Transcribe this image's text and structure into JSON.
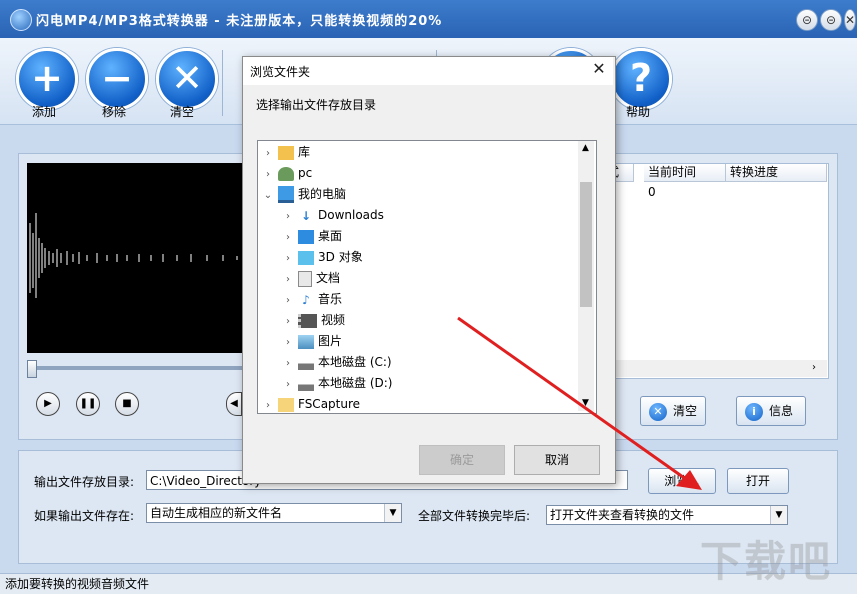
{
  "app": {
    "title": "闪电MP4/MP3格式转换器 - 未注册版本，只能转换视频的20%",
    "window_buttons": [
      "⊝",
      "⊝",
      "✕"
    ]
  },
  "toolbar": {
    "add_label": "添加",
    "remove_label": "移除",
    "clear_label": "清空",
    "help_label": "帮助"
  },
  "file_table": {
    "columns": [
      "格式",
      "当前时间",
      "转换进度"
    ],
    "row_current_time": "0"
  },
  "actions": {
    "clear_label": "清空",
    "info_label": "信息"
  },
  "output": {
    "dir_label": "输出文件存放目录:",
    "dir_value": "C:\\Video_Directory",
    "browse_label": "浏览...",
    "open_label": "打开",
    "exists_label": "如果输出文件存在:",
    "exists_value": "自动生成相应的新文件名",
    "done_label": "全部文件转换完毕后:",
    "done_value": "打开文件夹查看转换的文件"
  },
  "status_text": "添加要转换的视频音频文件",
  "watermark": "下载吧",
  "dialog": {
    "title": "浏览文件夹",
    "instruction": "选择输出文件存放目录",
    "ok_label": "确定",
    "cancel_label": "取消",
    "tree": [
      {
        "label": "库",
        "icon": "library-icon"
      },
      {
        "label": "pc",
        "icon": "user-icon"
      },
      {
        "label": "我的电脑",
        "icon": "computer-icon"
      },
      {
        "label": "Downloads",
        "icon": "downloads-icon"
      },
      {
        "label": "桌面",
        "icon": "desktop-icon"
      },
      {
        "label": "3D 对象",
        "icon": "3d-objects-icon"
      },
      {
        "label": "文档",
        "icon": "documents-icon"
      },
      {
        "label": "音乐",
        "icon": "music-icon"
      },
      {
        "label": "视频",
        "icon": "videos-icon"
      },
      {
        "label": "图片",
        "icon": "pictures-icon"
      },
      {
        "label": "本地磁盘 (C:)",
        "icon": "drive-icon"
      },
      {
        "label": "本地磁盘 (D:)",
        "icon": "drive-icon"
      },
      {
        "label": "FSCapture",
        "icon": "folder-icon"
      }
    ]
  },
  "colors": {
    "title_bar": "#2a63b4",
    "toolbar_button": "#1160c8",
    "arrow": "#e02020"
  }
}
